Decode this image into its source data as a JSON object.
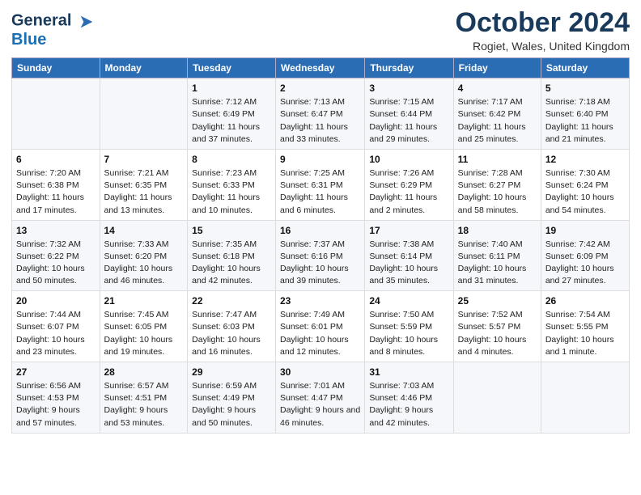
{
  "header": {
    "logo_line1": "General",
    "logo_line2": "Blue",
    "month": "October 2024",
    "location": "Rogiet, Wales, United Kingdom"
  },
  "days_of_week": [
    "Sunday",
    "Monday",
    "Tuesday",
    "Wednesday",
    "Thursday",
    "Friday",
    "Saturday"
  ],
  "weeks": [
    [
      {
        "day": "",
        "info": ""
      },
      {
        "day": "",
        "info": ""
      },
      {
        "day": "1",
        "info": "Sunrise: 7:12 AM\nSunset: 6:49 PM\nDaylight: 11 hours and 37 minutes."
      },
      {
        "day": "2",
        "info": "Sunrise: 7:13 AM\nSunset: 6:47 PM\nDaylight: 11 hours and 33 minutes."
      },
      {
        "day": "3",
        "info": "Sunrise: 7:15 AM\nSunset: 6:44 PM\nDaylight: 11 hours and 29 minutes."
      },
      {
        "day": "4",
        "info": "Sunrise: 7:17 AM\nSunset: 6:42 PM\nDaylight: 11 hours and 25 minutes."
      },
      {
        "day": "5",
        "info": "Sunrise: 7:18 AM\nSunset: 6:40 PM\nDaylight: 11 hours and 21 minutes."
      }
    ],
    [
      {
        "day": "6",
        "info": "Sunrise: 7:20 AM\nSunset: 6:38 PM\nDaylight: 11 hours and 17 minutes."
      },
      {
        "day": "7",
        "info": "Sunrise: 7:21 AM\nSunset: 6:35 PM\nDaylight: 11 hours and 13 minutes."
      },
      {
        "day": "8",
        "info": "Sunrise: 7:23 AM\nSunset: 6:33 PM\nDaylight: 11 hours and 10 minutes."
      },
      {
        "day": "9",
        "info": "Sunrise: 7:25 AM\nSunset: 6:31 PM\nDaylight: 11 hours and 6 minutes."
      },
      {
        "day": "10",
        "info": "Sunrise: 7:26 AM\nSunset: 6:29 PM\nDaylight: 11 hours and 2 minutes."
      },
      {
        "day": "11",
        "info": "Sunrise: 7:28 AM\nSunset: 6:27 PM\nDaylight: 10 hours and 58 minutes."
      },
      {
        "day": "12",
        "info": "Sunrise: 7:30 AM\nSunset: 6:24 PM\nDaylight: 10 hours and 54 minutes."
      }
    ],
    [
      {
        "day": "13",
        "info": "Sunrise: 7:32 AM\nSunset: 6:22 PM\nDaylight: 10 hours and 50 minutes."
      },
      {
        "day": "14",
        "info": "Sunrise: 7:33 AM\nSunset: 6:20 PM\nDaylight: 10 hours and 46 minutes."
      },
      {
        "day": "15",
        "info": "Sunrise: 7:35 AM\nSunset: 6:18 PM\nDaylight: 10 hours and 42 minutes."
      },
      {
        "day": "16",
        "info": "Sunrise: 7:37 AM\nSunset: 6:16 PM\nDaylight: 10 hours and 39 minutes."
      },
      {
        "day": "17",
        "info": "Sunrise: 7:38 AM\nSunset: 6:14 PM\nDaylight: 10 hours and 35 minutes."
      },
      {
        "day": "18",
        "info": "Sunrise: 7:40 AM\nSunset: 6:11 PM\nDaylight: 10 hours and 31 minutes."
      },
      {
        "day": "19",
        "info": "Sunrise: 7:42 AM\nSunset: 6:09 PM\nDaylight: 10 hours and 27 minutes."
      }
    ],
    [
      {
        "day": "20",
        "info": "Sunrise: 7:44 AM\nSunset: 6:07 PM\nDaylight: 10 hours and 23 minutes."
      },
      {
        "day": "21",
        "info": "Sunrise: 7:45 AM\nSunset: 6:05 PM\nDaylight: 10 hours and 19 minutes."
      },
      {
        "day": "22",
        "info": "Sunrise: 7:47 AM\nSunset: 6:03 PM\nDaylight: 10 hours and 16 minutes."
      },
      {
        "day": "23",
        "info": "Sunrise: 7:49 AM\nSunset: 6:01 PM\nDaylight: 10 hours and 12 minutes."
      },
      {
        "day": "24",
        "info": "Sunrise: 7:50 AM\nSunset: 5:59 PM\nDaylight: 10 hours and 8 minutes."
      },
      {
        "day": "25",
        "info": "Sunrise: 7:52 AM\nSunset: 5:57 PM\nDaylight: 10 hours and 4 minutes."
      },
      {
        "day": "26",
        "info": "Sunrise: 7:54 AM\nSunset: 5:55 PM\nDaylight: 10 hours and 1 minute."
      }
    ],
    [
      {
        "day": "27",
        "info": "Sunrise: 6:56 AM\nSunset: 4:53 PM\nDaylight: 9 hours and 57 minutes."
      },
      {
        "day": "28",
        "info": "Sunrise: 6:57 AM\nSunset: 4:51 PM\nDaylight: 9 hours and 53 minutes."
      },
      {
        "day": "29",
        "info": "Sunrise: 6:59 AM\nSunset: 4:49 PM\nDaylight: 9 hours and 50 minutes."
      },
      {
        "day": "30",
        "info": "Sunrise: 7:01 AM\nSunset: 4:47 PM\nDaylight: 9 hours and 46 minutes."
      },
      {
        "day": "31",
        "info": "Sunrise: 7:03 AM\nSunset: 4:46 PM\nDaylight: 9 hours and 42 minutes."
      },
      {
        "day": "",
        "info": ""
      },
      {
        "day": "",
        "info": ""
      }
    ]
  ]
}
